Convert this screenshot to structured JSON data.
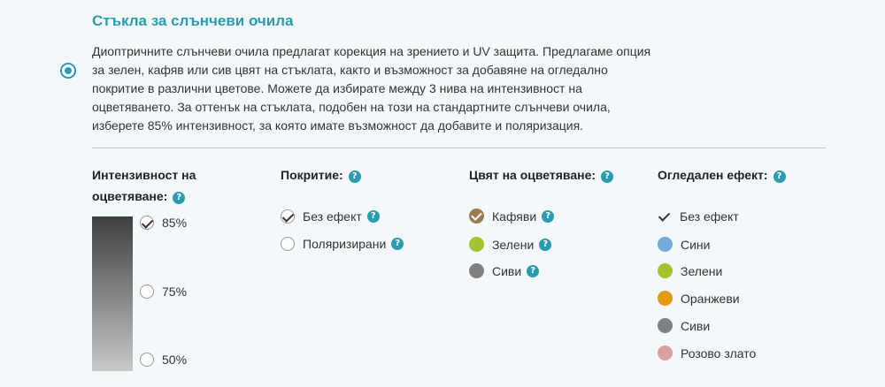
{
  "title": "Стъкла за слънчеви очила",
  "description": "Диоптричните слънчеви очила предлагат корекция на зрението и UV защита. Предлагаме опция за зелен, кафяв или сив цвят на стъклата, както и възможност за добавяне на огледално покритие в различни цветове. Можете да избирате между 3 нива на интензивност на оцветяването. За оттенък на стъклата, подобен на този на стандартните слънчеви очила, изберете 85% интензивност, за която имате възможност да добавите и поляризация.",
  "help_glyph": "?",
  "intensity": {
    "title_line1": "Интензивност на",
    "title_line2": "оцветяване:",
    "options": [
      {
        "label": "85%",
        "selected": true
      },
      {
        "label": "75%",
        "selected": false
      },
      {
        "label": "50%",
        "selected": false
      }
    ]
  },
  "coating": {
    "title": "Покритие:",
    "options": [
      {
        "label": "Без ефект",
        "selected": true
      },
      {
        "label": "Поляризирани",
        "selected": false
      }
    ]
  },
  "tint": {
    "title": "Цвят на оцветяване:",
    "options": [
      {
        "label": "Кафяви",
        "color": "#9b7b52",
        "selected": true
      },
      {
        "label": "Зелени",
        "color": "#a3c42f",
        "selected": false
      },
      {
        "label": "Сиви",
        "color": "#808080",
        "selected": false
      }
    ]
  },
  "mirror": {
    "title": "Огледален ефект:",
    "options": [
      {
        "label": "Без ефект",
        "color": "",
        "selected": true
      },
      {
        "label": "Сини",
        "color": "#74a9dc",
        "selected": false
      },
      {
        "label": "Зелени",
        "color": "#a3c42f",
        "selected": false
      },
      {
        "label": "Оранжеви",
        "color": "#e49a10",
        "selected": false
      },
      {
        "label": "Сиви",
        "color": "#808080",
        "selected": false
      },
      {
        "label": "Розово злато",
        "color": "#d8a19b",
        "selected": false
      }
    ]
  },
  "colors": {
    "accent": "#2a9bb0"
  }
}
